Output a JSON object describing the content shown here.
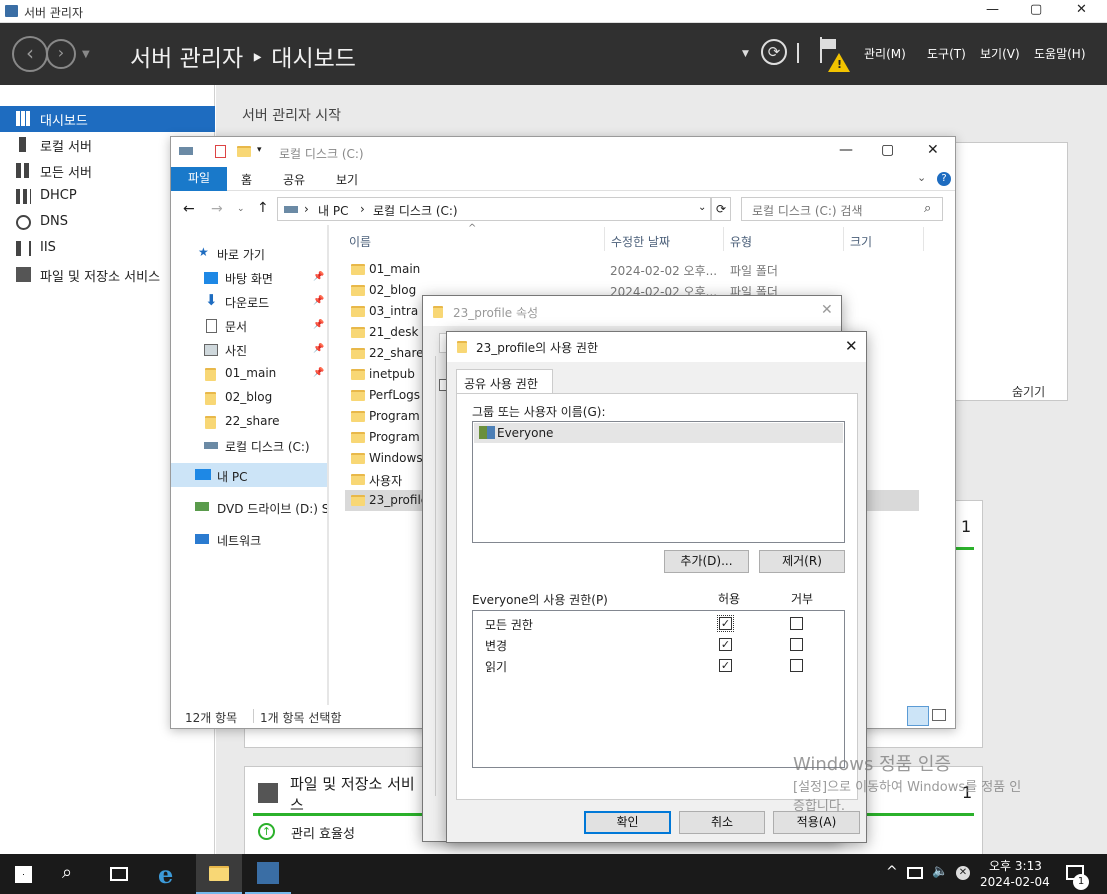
{
  "window": {
    "title": "서버 관리자",
    "min": "—",
    "max": "▢",
    "close": "✕"
  },
  "header": {
    "title": "서버 관리자 ‣ 대시보드",
    "menus": [
      "관리(M)",
      "도구(T)",
      "보기(V)",
      "도움말(H)"
    ]
  },
  "sidebar": {
    "items": [
      {
        "label": "대시보드",
        "selected": true
      },
      {
        "label": "로컬 서버"
      },
      {
        "label": "모든 서버"
      },
      {
        "label": "DHCP"
      },
      {
        "label": "DNS"
      },
      {
        "label": "IIS"
      },
      {
        "label": "파일 및 저장소 서비스"
      }
    ]
  },
  "main": {
    "welcome": "서버 관리자 시작",
    "hide": "숨기기",
    "tile_count": "1",
    "tile2_title": "파일 및 저장소 서비스",
    "tile2_title_l1": "파일 및 저장소 서비",
    "tile2_title_l2": "스",
    "tile2_count": "1",
    "manage": "관리 효율성"
  },
  "explorer": {
    "title": "로컬 디스크 (C:)",
    "tabs": [
      "파일",
      "홈",
      "공유",
      "보기"
    ],
    "path": [
      "내 PC",
      "로컬 디스크 (C:)"
    ],
    "search": "로컬 디스크 (C:) 검색",
    "columns": [
      "이름",
      "수정한 날짜",
      "유형",
      "크기"
    ],
    "quick": "바로 가기",
    "tree": [
      {
        "label": "바탕 화면",
        "pin": true
      },
      {
        "label": "다운로드",
        "pin": true
      },
      {
        "label": "문서",
        "pin": true
      },
      {
        "label": "사진",
        "pin": true
      },
      {
        "label": "01_main",
        "pin": true
      },
      {
        "label": "02_blog"
      },
      {
        "label": "22_share"
      },
      {
        "label": "로컬 디스크 (C:)"
      }
    ],
    "mypc": "내 PC",
    "dvd": "DVD 드라이브 (D:) S",
    "network": "네트워크",
    "files": [
      {
        "name": "01_main",
        "date": "2024-02-02 오후...",
        "type": "파일 폴더"
      },
      {
        "name": "02_blog",
        "date": "2024-02-02 오후...",
        "type": "파일 폴더"
      },
      {
        "name": "03_intra"
      },
      {
        "name": "21_desk"
      },
      {
        "name": "22_share"
      },
      {
        "name": "inetpub"
      },
      {
        "name": "PerfLogs"
      },
      {
        "name": "Program F"
      },
      {
        "name": "Program F"
      },
      {
        "name": "Windows"
      },
      {
        "name": "사용자"
      },
      {
        "name": "23_profile"
      }
    ],
    "status_count": "12개 항목",
    "status_sel": "1개 항목 선택함"
  },
  "props": {
    "title": "23_profile 속성"
  },
  "perm": {
    "title": "23_profile의 사용 권한",
    "tab": "공유 사용 권한",
    "group_label": "그룹 또는 사용자 이름(G):",
    "users": [
      "Everyone"
    ],
    "add": "추가(D)...",
    "remove": "제거(R)",
    "perm_label": "Everyone의 사용 권한(P)",
    "allow": "허용",
    "deny": "거부",
    "perms": [
      {
        "name": "모든 권한",
        "allow": true,
        "deny": false
      },
      {
        "name": "변경",
        "allow": true,
        "deny": false
      },
      {
        "name": "읽기",
        "allow": true,
        "deny": false
      }
    ],
    "ok": "확인",
    "cancel": "취소",
    "apply": "적용(A)"
  },
  "watermark": {
    "l1": "Windows 정품 인증",
    "l2": "[설정]으로 이동하여 Windows를 정품 인",
    "l3": "증합니다."
  },
  "taskbar": {
    "time": "오후 3:13",
    "date": "2024-02-04",
    "notif": "1"
  }
}
